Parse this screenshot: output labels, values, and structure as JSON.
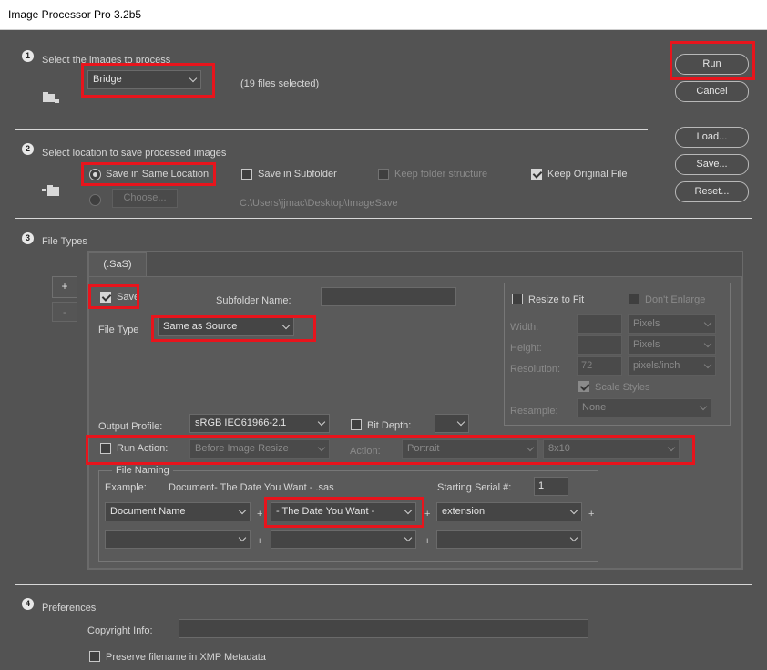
{
  "window": {
    "title": "Image Processor Pro 3.2b5"
  },
  "section1": {
    "step": "1",
    "heading": "Select the images to process",
    "source_select": "Bridge",
    "selection_status": "(19 files selected)"
  },
  "section2": {
    "step": "2",
    "heading": "Select location to save processed images",
    "save_same": "Save in Same Location",
    "save_subfolder": "Save in Subfolder",
    "keep_structure": "Keep folder structure",
    "keep_original": "Keep Original File",
    "choose_button": "Choose...",
    "path": "C:\\Users\\jjmac\\Desktop\\ImageSave"
  },
  "section3": {
    "step": "3",
    "heading": "File Types",
    "tab_label": "(.SaS)",
    "add_button": "+",
    "remove_button": "-",
    "save_label": "Save",
    "subfolder_label": "Subfolder Name:",
    "subfolder_value": "",
    "file_type_label": "File Type",
    "file_type_select": "Same as Source",
    "resize": {
      "resize_to_fit": "Resize to Fit",
      "dont_enlarge": "Don't Enlarge",
      "width_label": "Width:",
      "width_unit": "Pixels",
      "height_label": "Height:",
      "height_unit": "Pixels",
      "resolution_label": "Resolution:",
      "resolution_value": "72",
      "resolution_unit": "pixels/inch",
      "scale_styles": "Scale Styles",
      "resample_label": "Resample:",
      "resample_value": "None"
    },
    "output_profile_label": "Output Profile:",
    "output_profile_select": "sRGB IEC61966-2.1",
    "bit_depth_label": "Bit Depth:",
    "bit_depth_select": "",
    "run_action_label": "Run Action:",
    "run_action_when": "Before Image Resize",
    "action_label": "Action:",
    "action_set": "Portrait",
    "action_name": "8x10",
    "naming": {
      "title": "File Naming",
      "example_label": "Example:",
      "example_value": "Document- The Date You Want - .sas",
      "serial_label": "Starting Serial #:",
      "serial_value": "1",
      "row1": [
        "Document Name",
        "- The Date You Want -",
        "extension"
      ],
      "row2": [
        "",
        "",
        ""
      ],
      "plus": "+"
    }
  },
  "section4": {
    "step": "4",
    "heading": "Preferences",
    "copyright_label": "Copyright Info:",
    "copyright_value": "",
    "preserve_filename": "Preserve filename in XMP Metadata"
  },
  "buttons": {
    "run": "Run",
    "cancel": "Cancel",
    "load": "Load...",
    "save": "Save...",
    "reset": "Reset..."
  },
  "colors": {
    "background": "#535353",
    "highlight": "#e8141c"
  }
}
